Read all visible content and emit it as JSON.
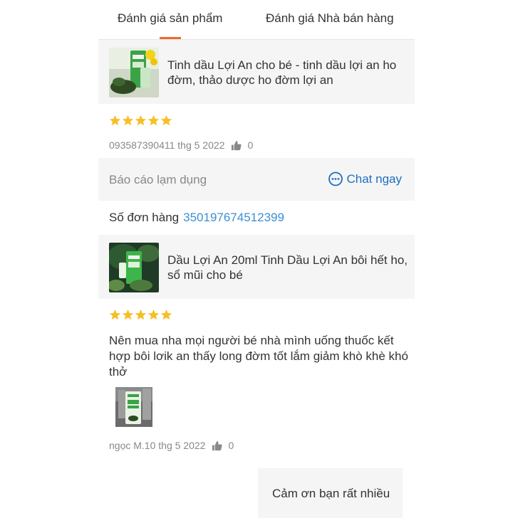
{
  "tabs": [
    {
      "label": "Đánh giá sản phẩm",
      "active": true
    },
    {
      "label": "Đánh giá Nhà bán hàng",
      "active": false
    }
  ],
  "accent_color": "#ee6a2a",
  "link_color": "#1e6fbf",
  "star_color": "#f7bf25",
  "review1": {
    "product_name": "Tinh dầu Lợi An cho bé - tinh dầu lợi an ho đờm, thảo dược ho đờm lợi an",
    "rating": 5,
    "meta": "093587390411 thg 5 2022",
    "likes": "0"
  },
  "actions": {
    "report_label": "Báo cáo lạm dụng",
    "chat_label": "Chat ngay"
  },
  "order": {
    "label": "Số đơn hàng",
    "number": "350197674512399"
  },
  "review2": {
    "product_name": "Dầu Lợi An 20ml Tinh Dầu Lợi An bôi hết ho, sổ mũi cho bé",
    "rating": 5,
    "text": "Nên mua nha mọi người bé nhà mình uống thuốc kết hợp bôi lơik an thấy long đờm tốt lắm giảm khò khè khó thở",
    "meta": "ngọc M.10 thg 5 2022",
    "likes": "0"
  },
  "reply_text": "Cảm ơn bạn rất nhiều",
  "icons": [
    "star-icon",
    "thumbs-up-icon",
    "chat-bubble-icon"
  ]
}
